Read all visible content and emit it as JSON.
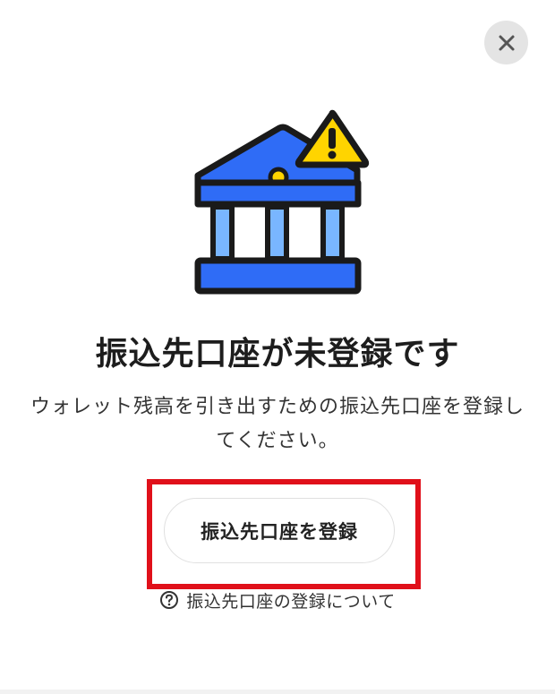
{
  "dialog": {
    "title": "振込先口座が未登録です",
    "description": "ウォレット残高を引き出すための振込先口座を登録してください。",
    "register_button_label": "振込先口座を登録",
    "help_link_label": "振込先口座の登録について"
  },
  "icons": {
    "close": "close-icon",
    "illustration": "bank-warning-icon",
    "help": "question-circle-icon"
  },
  "colors": {
    "bank_blue": "#2f6cf6",
    "pillar_light_blue": "#79b6ff",
    "warning_yellow": "#ffd400",
    "highlight_red": "#e0101a",
    "close_bg": "#e4e4e4"
  }
}
